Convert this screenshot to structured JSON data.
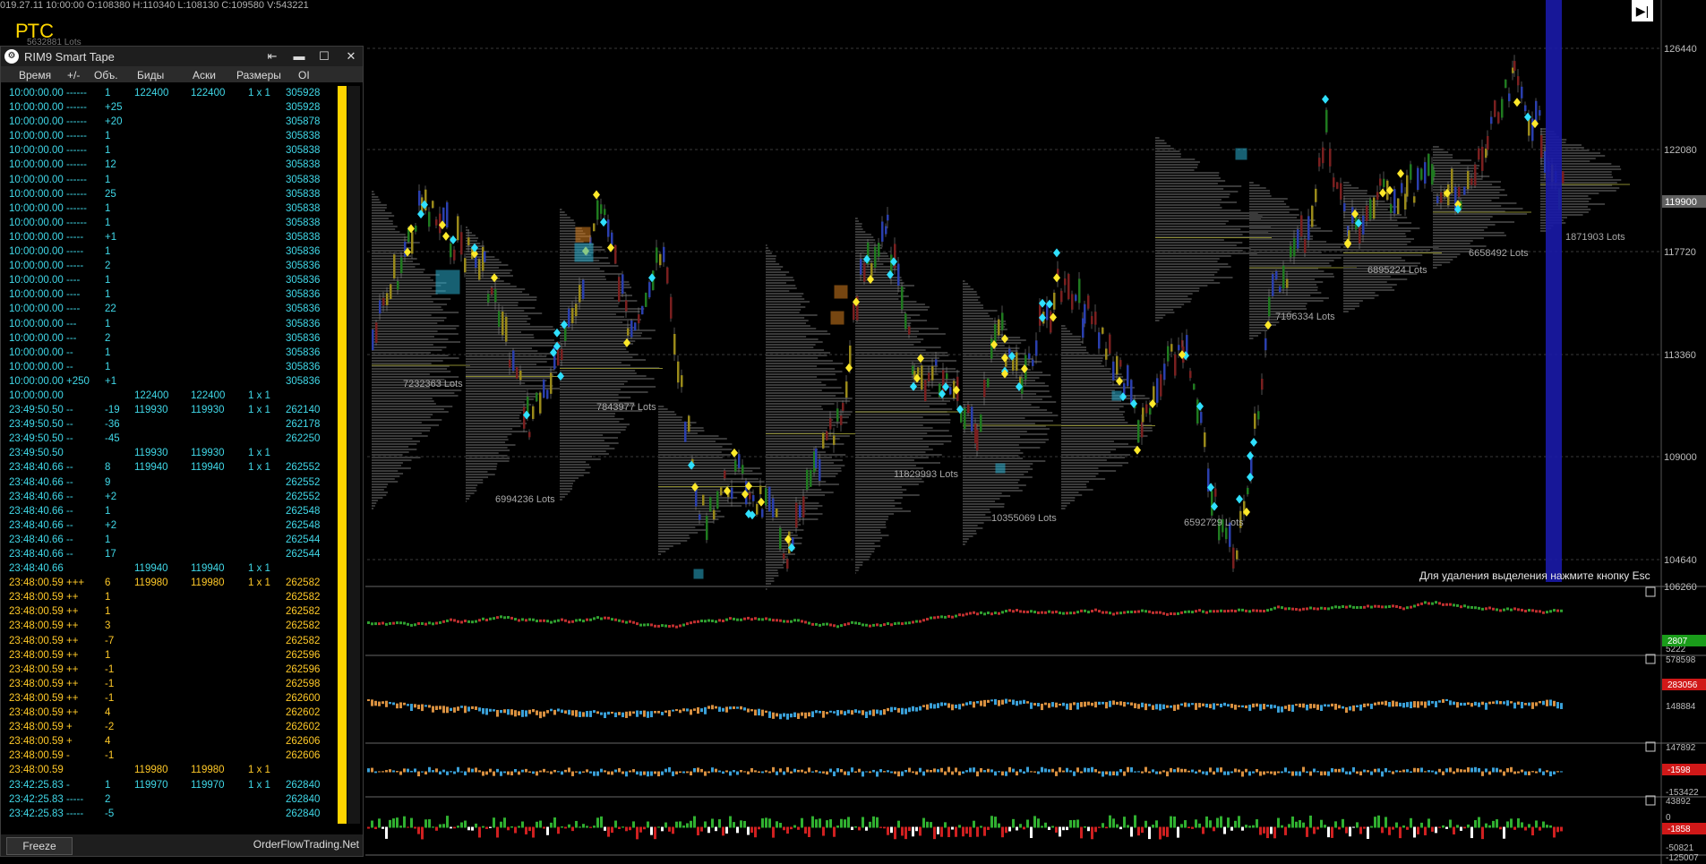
{
  "top_info": "019.27.11 10:00:00 O:108380 H:110340 L:108130 C:109580 V:543221",
  "symbol": "РТС",
  "esc_note": "Для удаления выделения нажмите кнопку Esc",
  "top_right_button": "▶|",
  "price_axis": {
    "labels": [
      "126440",
      "122080",
      "117720",
      "113360",
      "109000",
      "104640",
      "106260"
    ],
    "current_price": "119900",
    "current_price_color": "#606060"
  },
  "profile_labels": [
    {
      "text": "7232363 Lots"
    },
    {
      "text": "6994236 Lots"
    },
    {
      "text": "7843977 Lots"
    },
    {
      "text": "11829993 Lots"
    },
    {
      "text": "10355069 Lots"
    },
    {
      "text": "6592729 Lots"
    },
    {
      "text": "7196334 Lots"
    },
    {
      "text": "6895224 Lots"
    },
    {
      "text": "6658492 Lots"
    },
    {
      "text": "1871903 Lots"
    }
  ],
  "top_left_ghost_label": "5632881 Lots",
  "subpanels": [
    {
      "name": "delta",
      "axis_labels": [
        "5222"
      ],
      "value_badge": "2807",
      "badge_color": "#1a9c1a"
    },
    {
      "name": "cum-delta",
      "axis_labels": [
        "578598",
        "148884"
      ],
      "value_badge": "283056",
      "badge_color": "#d01818"
    },
    {
      "name": "oi-change",
      "axis_labels": [
        "147892",
        "-153422"
      ],
      "value_badge": "-1598",
      "badge_color": "#d01818"
    },
    {
      "name": "volume-bars",
      "axis_labels": [
        "43892",
        "0",
        "-50821",
        "-125007"
      ],
      "value_badge": "-1858",
      "badge_color": "#d01818"
    }
  ],
  "tape": {
    "title": "RIM9 Smart Tape",
    "window_buttons": {
      "pin": "⇤",
      "minimize": "▬",
      "maximize": "☐",
      "close": "✕"
    },
    "columns": [
      "Время",
      "+/-",
      "Объ.",
      "Биды",
      "Аски",
      "Размеры",
      "OI"
    ],
    "rows": [
      {
        "time": "10:00:00.00",
        "sign": "------",
        "vol": "1",
        "bid": "122400",
        "ask": "122400",
        "size": "1 x 1",
        "oi": "305928",
        "color": "cyan"
      },
      {
        "time": "10:00:00.00",
        "sign": "------",
        "vol": "+25",
        "bid": "",
        "ask": "",
        "size": "",
        "oi": "305928",
        "color": "cyan"
      },
      {
        "time": "10:00:00.00",
        "sign": "------",
        "vol": "+20",
        "bid": "",
        "ask": "",
        "size": "",
        "oi": "305878",
        "color": "cyan"
      },
      {
        "time": "10:00:00.00",
        "sign": "------",
        "vol": "1",
        "bid": "",
        "ask": "",
        "size": "",
        "oi": "305838",
        "color": "cyan"
      },
      {
        "time": "10:00:00.00",
        "sign": "------",
        "vol": "1",
        "bid": "",
        "ask": "",
        "size": "",
        "oi": "305838",
        "color": "cyan"
      },
      {
        "time": "10:00:00.00",
        "sign": "------",
        "vol": "12",
        "bid": "",
        "ask": "",
        "size": "",
        "oi": "305838",
        "color": "cyan"
      },
      {
        "time": "10:00:00.00",
        "sign": "------",
        "vol": "1",
        "bid": "",
        "ask": "",
        "size": "",
        "oi": "305838",
        "color": "cyan"
      },
      {
        "time": "10:00:00.00",
        "sign": "------",
        "vol": "25",
        "bid": "",
        "ask": "",
        "size": "",
        "oi": "305838",
        "color": "cyan"
      },
      {
        "time": "10:00:00.00",
        "sign": "------",
        "vol": "1",
        "bid": "",
        "ask": "",
        "size": "",
        "oi": "305838",
        "color": "cyan"
      },
      {
        "time": "10:00:00.00",
        "sign": "------",
        "vol": "1",
        "bid": "",
        "ask": "",
        "size": "",
        "oi": "305838",
        "color": "cyan"
      },
      {
        "time": "10:00:00.00",
        "sign": "-----",
        "vol": "+1",
        "bid": "",
        "ask": "",
        "size": "",
        "oi": "305838",
        "color": "cyan"
      },
      {
        "time": "10:00:00.00",
        "sign": "-----",
        "vol": "1",
        "bid": "",
        "ask": "",
        "size": "",
        "oi": "305836",
        "color": "cyan"
      },
      {
        "time": "10:00:00.00",
        "sign": "-----",
        "vol": "2",
        "bid": "",
        "ask": "",
        "size": "",
        "oi": "305836",
        "color": "cyan"
      },
      {
        "time": "10:00:00.00",
        "sign": "----",
        "vol": "1",
        "bid": "",
        "ask": "",
        "size": "",
        "oi": "305836",
        "color": "cyan"
      },
      {
        "time": "10:00:00.00",
        "sign": "----",
        "vol": "1",
        "bid": "",
        "ask": "",
        "size": "",
        "oi": "305836",
        "color": "cyan"
      },
      {
        "time": "10:00:00.00",
        "sign": "----",
        "vol": "22",
        "bid": "",
        "ask": "",
        "size": "",
        "oi": "305836",
        "color": "cyan"
      },
      {
        "time": "10:00:00.00",
        "sign": "---",
        "vol": "1",
        "bid": "",
        "ask": "",
        "size": "",
        "oi": "305836",
        "color": "cyan"
      },
      {
        "time": "10:00:00.00",
        "sign": "---",
        "vol": "2",
        "bid": "",
        "ask": "",
        "size": "",
        "oi": "305836",
        "color": "cyan"
      },
      {
        "time": "10:00:00.00",
        "sign": "--",
        "vol": "1",
        "bid": "",
        "ask": "",
        "size": "",
        "oi": "305836",
        "color": "cyan"
      },
      {
        "time": "10:00:00.00",
        "sign": "--",
        "vol": "1",
        "bid": "",
        "ask": "",
        "size": "",
        "oi": "305836",
        "color": "cyan"
      },
      {
        "time": "10:00:00.00",
        "sign": "+250",
        "vol": "+1",
        "bid": "",
        "ask": "",
        "size": "",
        "oi": "305836",
        "color": "cyan"
      },
      {
        "time": "10:00:00.00",
        "sign": "",
        "vol": "",
        "bid": "122400",
        "ask": "122400",
        "size": "1 x 1",
        "oi": "",
        "color": "cyan"
      },
      {
        "time": "23:49:50.50",
        "sign": "--",
        "vol": "-19",
        "bid": "119930",
        "ask": "119930",
        "size": "1 x 1",
        "oi": "262140",
        "color": "cyan"
      },
      {
        "time": "23:49:50.50",
        "sign": "--",
        "vol": "-36",
        "bid": "",
        "ask": "",
        "size": "",
        "oi": "262178",
        "color": "cyan"
      },
      {
        "time": "23:49:50.50",
        "sign": "--",
        "vol": "-45",
        "bid": "",
        "ask": "",
        "size": "",
        "oi": "262250",
        "color": "cyan"
      },
      {
        "time": "23:49:50.50",
        "sign": "",
        "vol": "",
        "bid": "119930",
        "ask": "119930",
        "size": "1 x 1",
        "oi": "",
        "color": "cyan"
      },
      {
        "time": "23:48:40.66",
        "sign": "--",
        "vol": "8",
        "bid": "119940",
        "ask": "119940",
        "size": "1 x 1",
        "oi": "262552",
        "color": "cyan"
      },
      {
        "time": "23:48:40.66",
        "sign": "--",
        "vol": "9",
        "bid": "",
        "ask": "",
        "size": "",
        "oi": "262552",
        "color": "cyan"
      },
      {
        "time": "23:48:40.66",
        "sign": "--",
        "vol": "+2",
        "bid": "",
        "ask": "",
        "size": "",
        "oi": "262552",
        "color": "cyan"
      },
      {
        "time": "23:48:40.66",
        "sign": "--",
        "vol": "1",
        "bid": "",
        "ask": "",
        "size": "",
        "oi": "262548",
        "color": "cyan"
      },
      {
        "time": "23:48:40.66",
        "sign": "--",
        "vol": "+2",
        "bid": "",
        "ask": "",
        "size": "",
        "oi": "262548",
        "color": "cyan"
      },
      {
        "time": "23:48:40.66",
        "sign": "--",
        "vol": "1",
        "bid": "",
        "ask": "",
        "size": "",
        "oi": "262544",
        "color": "cyan"
      },
      {
        "time": "23:48:40.66",
        "sign": "--",
        "vol": "17",
        "bid": "",
        "ask": "",
        "size": "",
        "oi": "262544",
        "color": "cyan"
      },
      {
        "time": "23:48:40.66",
        "sign": "",
        "vol": "",
        "bid": "119940",
        "ask": "119940",
        "size": "1 x 1",
        "oi": "",
        "color": "cyan"
      },
      {
        "time": "23:48:00.59",
        "sign": "+++",
        "vol": "6",
        "bid": "119980",
        "ask": "119980",
        "size": "1 x 1",
        "oi": "262582",
        "color": "gold"
      },
      {
        "time": "23:48:00.59",
        "sign": "++",
        "vol": "1",
        "bid": "",
        "ask": "",
        "size": "",
        "oi": "262582",
        "color": "gold"
      },
      {
        "time": "23:48:00.59",
        "sign": "++",
        "vol": "1",
        "bid": "",
        "ask": "",
        "size": "",
        "oi": "262582",
        "color": "gold"
      },
      {
        "time": "23:48:00.59",
        "sign": "++",
        "vol": "3",
        "bid": "",
        "ask": "",
        "size": "",
        "oi": "262582",
        "color": "gold"
      },
      {
        "time": "23:48:00.59",
        "sign": "++",
        "vol": "-7",
        "bid": "",
        "ask": "",
        "size": "",
        "oi": "262582",
        "color": "gold"
      },
      {
        "time": "23:48:00.59",
        "sign": "++",
        "vol": "1",
        "bid": "",
        "ask": "",
        "size": "",
        "oi": "262596",
        "color": "gold"
      },
      {
        "time": "23:48:00.59",
        "sign": "++",
        "vol": "-1",
        "bid": "",
        "ask": "",
        "size": "",
        "oi": "262596",
        "color": "gold"
      },
      {
        "time": "23:48:00.59",
        "sign": "++",
        "vol": "-1",
        "bid": "",
        "ask": "",
        "size": "",
        "oi": "262598",
        "color": "gold"
      },
      {
        "time": "23:48:00.59",
        "sign": "++",
        "vol": "-1",
        "bid": "",
        "ask": "",
        "size": "",
        "oi": "262600",
        "color": "gold"
      },
      {
        "time": "23:48:00.59",
        "sign": "++",
        "vol": "4",
        "bid": "",
        "ask": "",
        "size": "",
        "oi": "262602",
        "color": "gold"
      },
      {
        "time": "23:48:00.59",
        "sign": "+",
        "vol": "-2",
        "bid": "",
        "ask": "",
        "size": "",
        "oi": "262602",
        "color": "gold"
      },
      {
        "time": "23:48:00.59",
        "sign": "+",
        "vol": "4",
        "bid": "",
        "ask": "",
        "size": "",
        "oi": "262606",
        "color": "gold"
      },
      {
        "time": "23:48:00.59",
        "sign": "-",
        "vol": "-1",
        "bid": "",
        "ask": "",
        "size": "",
        "oi": "262606",
        "color": "gold"
      },
      {
        "time": "23:48:00.59",
        "sign": "",
        "vol": "",
        "bid": "119980",
        "ask": "119980",
        "size": "1 x 1",
        "oi": "",
        "color": "gold"
      },
      {
        "time": "23:42:25.83",
        "sign": "-",
        "vol": "1",
        "bid": "119970",
        "ask": "119970",
        "size": "1 x 1",
        "oi": "262840",
        "color": "cyan"
      },
      {
        "time": "23:42:25.83",
        "sign": "-----",
        "vol": "2",
        "bid": "",
        "ask": "",
        "size": "",
        "oi": "262840",
        "color": "cyan"
      },
      {
        "time": "23:42:25.83",
        "sign": "-----",
        "vol": "-5",
        "bid": "",
        "ask": "",
        "size": "",
        "oi": "262840",
        "color": "cyan"
      }
    ],
    "freeze_label": "Freeze",
    "brand": "OrderFlowTrading.Net"
  }
}
